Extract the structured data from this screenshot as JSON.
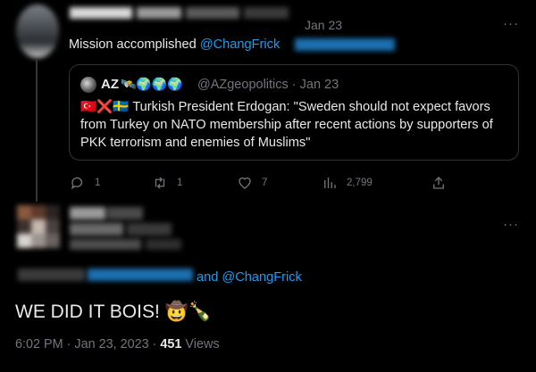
{
  "tweet1": {
    "date": "Jan 23",
    "more": "···",
    "text": "Mission accomplished",
    "mention": "@ChangFrick",
    "quote": {
      "name": "AZ",
      "emojis": "🛰️🌍🌍🌍",
      "handle": "@AZgeopolitics · Jan 23",
      "flags": "🇹🇷❌🇸🇪",
      "text": "Turkish President Erdogan: \"Sweden should not expect favors from Turkey on NATO membership after recent actions by supporters of PKK terrorism and enemies of Muslims\""
    },
    "actions": {
      "replies": "1",
      "retweets": "1",
      "likes": "7",
      "views": "2,799"
    },
    "icons": [
      "reply-icon",
      "retweet-icon",
      "like-icon",
      "views-icon",
      "share-icon"
    ]
  },
  "tweet2": {
    "more": "···",
    "reply_suffix": "and @ChangFrick",
    "text": "WE DID IT BOIS! 🤠🍾",
    "time": "6:02 PM · Jan 23, 2023 · ",
    "views_count": "451",
    "views_label": " Views"
  },
  "colors": {
    "background": "#000000",
    "text": "#e7e9ea",
    "muted": "#71767b",
    "link": "#1d9bf0",
    "border": "#2f3336"
  }
}
